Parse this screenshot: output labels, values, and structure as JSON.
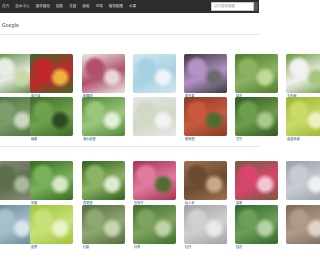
{
  "nav": [
    "花卉",
    "苗木中心",
    "園林圖紙",
    "園藝",
    "花園",
    "論壇",
    "市場",
    "植物圖鑑",
    "水果"
  ],
  "search": {
    "placeholder": "站內搜索關鍵",
    "icon": "search-icon"
  },
  "brand_text": "Google",
  "grid": {
    "rows": [
      {
        "tiles": [
          {
            "caption": "",
            "colors": [
              "#5f8a3f",
              "#e8ece3",
              "#c9d8a8"
            ]
          },
          {
            "caption": "康乃馨",
            "colors": [
              "#3d6a24",
              "#c4262e",
              "#f0b23b"
            ]
          },
          {
            "caption": "紫羅蘭",
            "colors": [
              "#ece5e0",
              "#b0506a",
              "#e8d6da"
            ]
          },
          {
            "caption": "",
            "colors": [
              "#d0e8f2",
              "#a7cfe2",
              "#eef5f8"
            ]
          },
          {
            "caption": "薰衣草",
            "colors": [
              "#3a3a3a",
              "#b391c8",
              "#6b6b6b"
            ]
          },
          {
            "caption": "草花",
            "colors": [
              "#4e7d2f",
              "#8cb361",
              "#c0d99a"
            ]
          },
          {
            "caption": "五色梅",
            "colors": [
              "#6c9a3d",
              "#f2f2f2",
              "#a8c47e"
            ]
          }
        ]
      },
      {
        "tiles": [
          {
            "caption": "",
            "colors": [
              "#4e7140",
              "#7d9d6b",
              "#c9d6c0"
            ]
          },
          {
            "caption": "綠蘿",
            "colors": [
              "#3e6b2b",
              "#6fa04c",
              "#2b4a1f"
            ]
          },
          {
            "caption": "滴水觀音",
            "colors": [
              "#4f8a3a",
              "#9bc77a",
              "#e4eedd"
            ]
          },
          {
            "caption": "",
            "colors": [
              "#e6e6e6",
              "#cfd9c3",
              "#f3f3f3"
            ]
          },
          {
            "caption": "發財樹",
            "colors": [
              "#8c3b24",
              "#c95a3f",
              "#4c6e2f"
            ]
          },
          {
            "caption": "文竹",
            "colors": [
              "#2f5a24",
              "#6e9e4c",
              "#a8c98a"
            ]
          },
          {
            "caption": "金邊黃楊",
            "colors": [
              "#96b830",
              "#c9d96a",
              "#eef0c0"
            ]
          }
        ]
      },
      {
        "tiles": [
          {
            "caption": "",
            "colors": [
              "#8a8a7a",
              "#5c6e4b",
              "#a9b79a"
            ]
          },
          {
            "caption": "吊蘭",
            "colors": [
              "#386b22",
              "#7ab25a",
              "#d4e7c4"
            ]
          },
          {
            "caption": "虎尾蘭",
            "colors": [
              "#355f20",
              "#8bb564",
              "#dde9d0"
            ]
          },
          {
            "caption": "富貴竹",
            "colors": [
              "#a8324f",
              "#e07aa0",
              "#4d6e2f"
            ]
          },
          {
            "caption": "仙人掌",
            "colors": [
              "#a07050",
              "#6b4a30",
              "#c9a88a"
            ]
          },
          {
            "caption": "茉莉",
            "colors": [
              "#7a5a3e",
              "#d9456e",
              "#f2c6d2"
            ]
          },
          {
            "caption": "",
            "colors": [
              "#9aa0a8",
              "#c8ccd2",
              "#eef0f2"
            ]
          }
        ]
      },
      {
        "tiles": [
          {
            "caption": "",
            "colors": [
              "#6a8a9a",
              "#a8c0cc",
              "#d8e4ea"
            ]
          },
          {
            "caption": "蘆薈",
            "colors": [
              "#9dc53a",
              "#c9e07a",
              "#eaf2c8"
            ]
          },
          {
            "caption": "杜鵑",
            "colors": [
              "#566c3e",
              "#8fa870",
              "#c6d4b0"
            ]
          },
          {
            "caption": "月季",
            "colors": [
              "#3f6e2e",
              "#7ea35e",
              "#bdd2a6"
            ]
          },
          {
            "caption": "牡丹",
            "colors": [
              "#a3a3a3",
              "#d0d0d0",
              "#eaeaea"
            ]
          },
          {
            "caption": "桂花",
            "colors": [
              "#2e6a2e",
              "#6f9e5a",
              "#b8d0a8"
            ]
          },
          {
            "caption": "",
            "colors": [
              "#7c6a5a",
              "#b09a88",
              "#e0d4ca"
            ]
          }
        ]
      }
    ]
  }
}
